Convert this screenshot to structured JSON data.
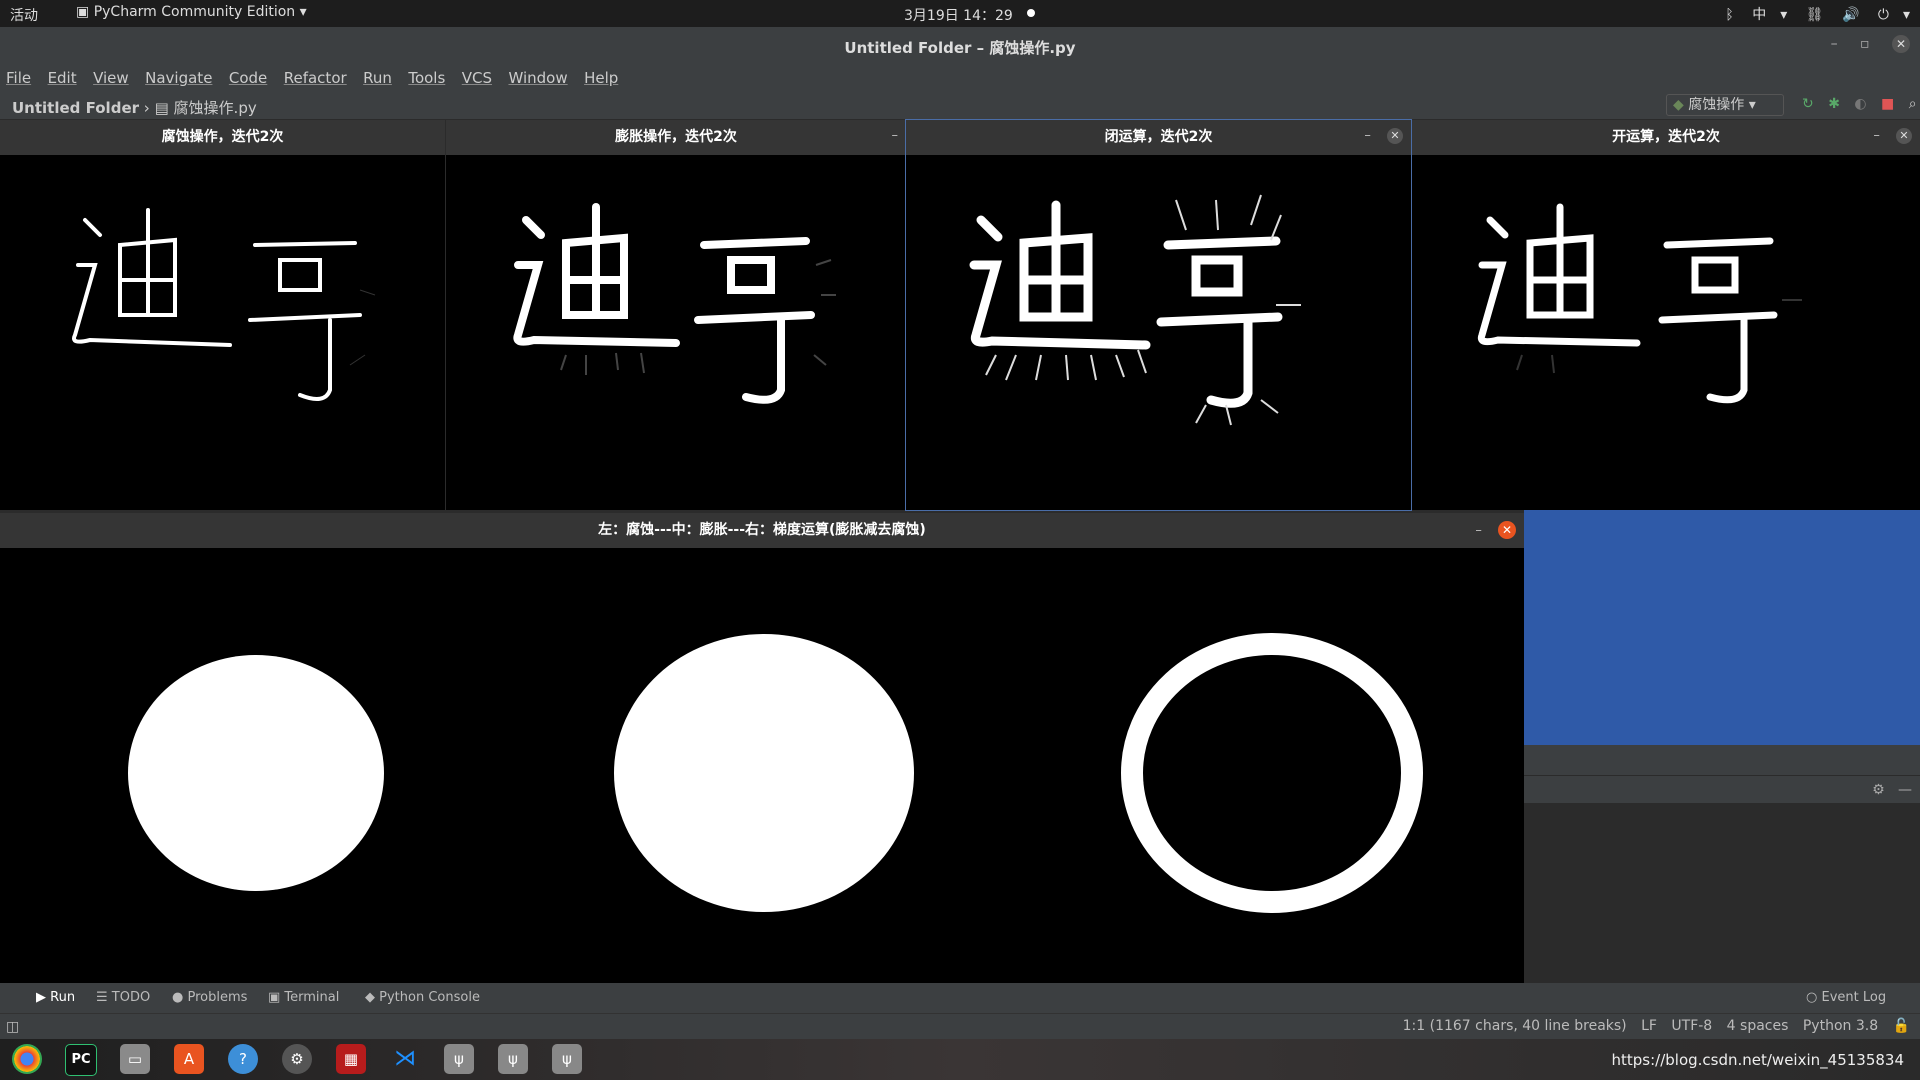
{
  "system_bar": {
    "activities": "活动",
    "app_name": "PyCharm Community Edition",
    "clock": "3月19日 14：29",
    "input_method": "中"
  },
  "window": {
    "title": "Untitled Folder – 腐蚀操作.py"
  },
  "menu": [
    "File",
    "Edit",
    "View",
    "Navigate",
    "Code",
    "Refactor",
    "Run",
    "Tools",
    "VCS",
    "Window",
    "Help"
  ],
  "navbar": {
    "project": "Untitled Folder",
    "file": "腐蚀操作.py",
    "run_config": "腐蚀操作"
  },
  "image_windows": [
    {
      "title": "腐蚀操作，迭代2次"
    },
    {
      "title": "膨胀操作，迭代2次"
    },
    {
      "title": "闭运算，迭代2次"
    },
    {
      "title": "开运算，迭代2次"
    }
  ],
  "gradient_window": {
    "title": "左：腐蚀---中：膨胀---右：梯度运算(膨胀减去腐蚀)"
  },
  "tool_tabs": {
    "run": "Run",
    "todo": "TODO",
    "problems": "Problems",
    "terminal": "Terminal",
    "python_console": "Python Console",
    "event_log": "Event Log"
  },
  "status_bar": {
    "position": "1:1 (1167 chars, 40 line breaks)",
    "line_sep": "LF",
    "encoding": "UTF-8",
    "indent": "4 spaces",
    "interpreter": "Python 3.8"
  },
  "dock": {
    "watermark_url": "https://blog.csdn.net/weixin_45135834"
  },
  "colors": {
    "ide_bg": "#3c3f41",
    "panel_blue": "#2f5aa8",
    "close_red": "#e95420"
  }
}
